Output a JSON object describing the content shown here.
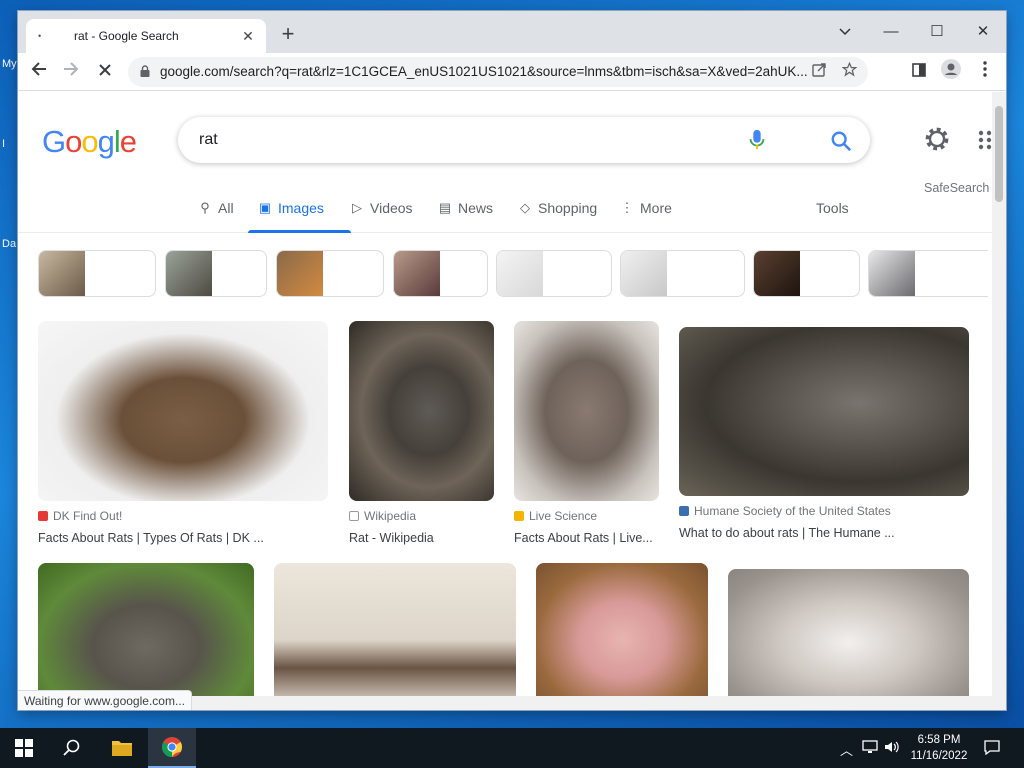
{
  "desktop": {
    "label_1": "My",
    "label_2": "I",
    "label_3": "Da"
  },
  "browser": {
    "tab_title": "rat - Google Search",
    "url": "google.com/search?q=rat&rlz=1C1GCEA_enUS1021US1021&source=lnms&tbm=isch&sa=X&ved=2ahUK...",
    "status_text": "Waiting for www.google.com..."
  },
  "google": {
    "logo_letters": [
      "G",
      "o",
      "o",
      "g",
      "l",
      "e"
    ],
    "logo_colors": [
      "#4285f4",
      "#ea4335",
      "#fbbc05",
      "#4285f4",
      "#34a853",
      "#ea4335"
    ],
    "query": "rat",
    "safesearch_label": "SafeSearch",
    "tabs": [
      {
        "label": "All",
        "icon": "search-icon"
      },
      {
        "label": "Images",
        "icon": "image-icon"
      },
      {
        "label": "Videos",
        "icon": "video-icon"
      },
      {
        "label": "News",
        "icon": "news-icon"
      },
      {
        "label": "Shopping",
        "icon": "tag-icon"
      },
      {
        "label": "More",
        "icon": "more-vert-icon"
      }
    ],
    "active_tab": "Images",
    "tools_label": "Tools",
    "accent": "#1a73e8"
  },
  "results": [
    {
      "source": "DK Find Out!",
      "title": "Facts About Rats | Types Of Rats | DK ..."
    },
    {
      "source": "Wikipedia",
      "title": "Rat - Wikipedia"
    },
    {
      "source": "Live Science",
      "title": "Facts About Rats | Live..."
    },
    {
      "source": "Humane Society of the United States",
      "title": "What to do about rats | The Humane ..."
    }
  ],
  "taskbar": {
    "time": "6:58 PM",
    "date": "11/16/2022"
  }
}
